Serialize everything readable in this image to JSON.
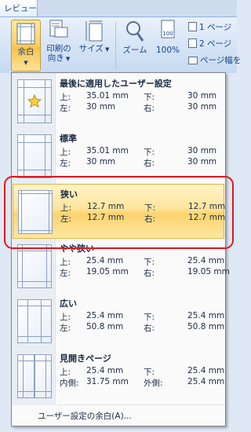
{
  "ribbon": {
    "active_tab": "レビュー",
    "margins_label": "余白",
    "orientation_label_1": "印刷の",
    "orientation_label_2": "向き",
    "size_label": "サイズ",
    "zoom_label": "ズーム",
    "zoom100_label": "100%",
    "one_page_label": "1 ページ",
    "two_page_label": "2 ページ",
    "page_width_label": "ページ幅を"
  },
  "menu": {
    "items": [
      {
        "title": "最後に適用したユーザー設定",
        "top_label": "上:",
        "top": "35.01 mm",
        "bottom_label": "下:",
        "bottom": "30 mm",
        "left_label": "左:",
        "left": "30 mm",
        "right_label": "右:",
        "right": "30 mm"
      },
      {
        "title": "標準",
        "top_label": "上:",
        "top": "35.01 mm",
        "bottom_label": "下:",
        "bottom": "30 mm",
        "left_label": "左:",
        "left": "30 mm",
        "right_label": "右:",
        "right": "30 mm"
      },
      {
        "title": "狭い",
        "top_label": "上:",
        "top": "12.7 mm",
        "bottom_label": "下:",
        "bottom": "12.7 mm",
        "left_label": "左:",
        "left": "12.7 mm",
        "right_label": "右:",
        "right": "12.7 mm"
      },
      {
        "title": "やや狭い",
        "top_label": "上:",
        "top": "25.4 mm",
        "bottom_label": "下:",
        "bottom": "25.4 mm",
        "left_label": "左:",
        "left": "19.05 mm",
        "right_label": "右:",
        "right": "19.05 mm"
      },
      {
        "title": "広い",
        "top_label": "上:",
        "top": "25.4 mm",
        "bottom_label": "下:",
        "bottom": "25.4 mm",
        "left_label": "左:",
        "left": "50.8 mm",
        "right_label": "右:",
        "right": "50.8 mm"
      },
      {
        "title": "見開きページ",
        "top_label": "上:",
        "top": "25.4 mm",
        "bottom_label": "下:",
        "bottom": "25.4 mm",
        "left_label": "内側:",
        "left": "31.75 mm",
        "right_label": "外側:",
        "right": "25.4 mm"
      }
    ],
    "custom_label": "ユーザー設定の余白(A)..."
  }
}
